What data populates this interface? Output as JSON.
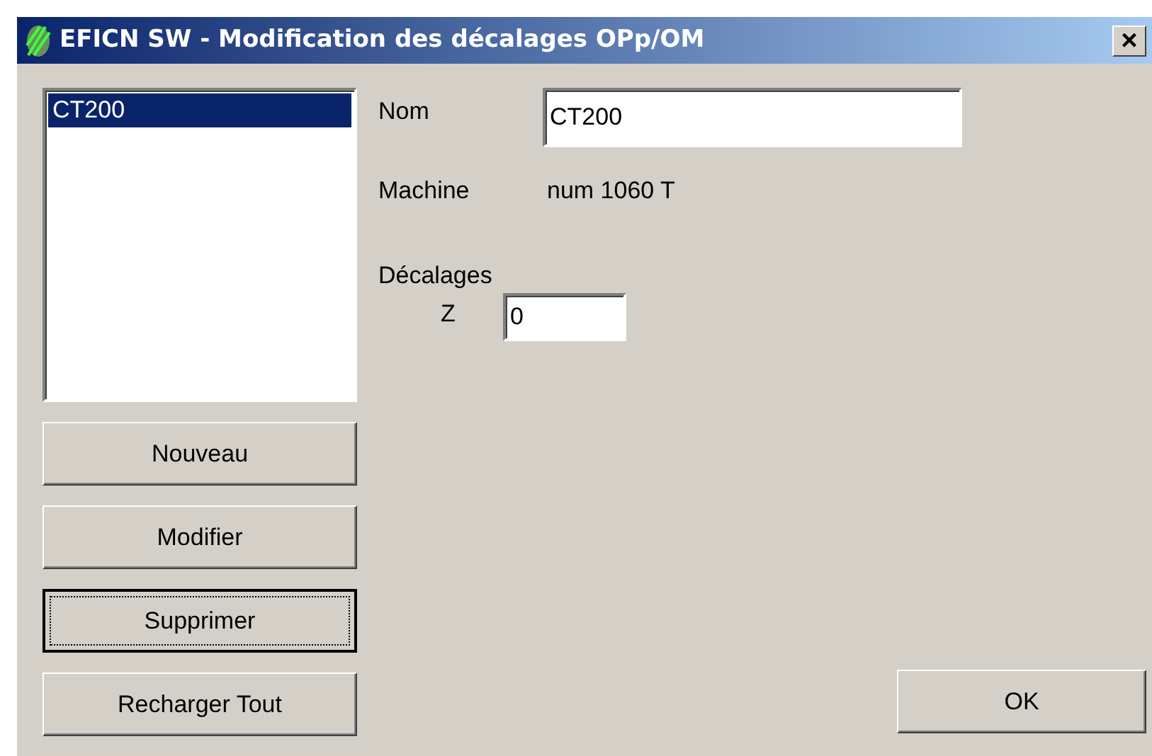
{
  "window": {
    "title": "EFICN SW - Modification des décalages OPp/OM",
    "close": "×"
  },
  "list": {
    "items": [
      {
        "label": "CT200",
        "selected": true
      }
    ]
  },
  "form": {
    "nom_label": "Nom",
    "nom_value": "CT200",
    "machine_label": "Machine",
    "machine_value": "num 1060 T",
    "decalages_label": "Décalages",
    "z_label": "Z",
    "z_value": "0"
  },
  "buttons": [
    {
      "label": "Nouveau",
      "focused": false
    },
    {
      "label": "Modifier",
      "focused": false
    },
    {
      "label": "Supprimer",
      "focused": true
    },
    {
      "label": "Recharger Tout",
      "focused": false
    }
  ],
  "ok_button": {
    "label": "OK",
    "focused": false
  }
}
